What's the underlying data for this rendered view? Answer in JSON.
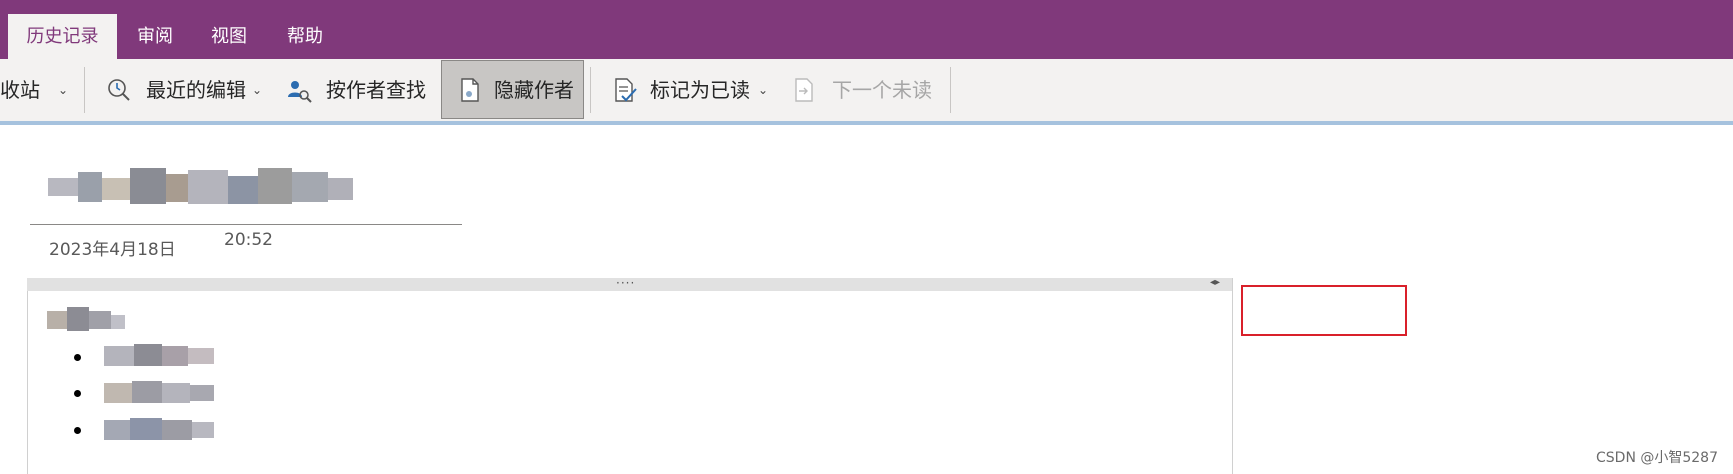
{
  "tabs": [
    {
      "label": "历史记录",
      "active": true
    },
    {
      "label": "审阅",
      "active": false
    },
    {
      "label": "视图",
      "active": false
    },
    {
      "label": "帮助",
      "active": false
    }
  ],
  "ribbon": {
    "recycle_bin": "回收站",
    "recent_edits": "最近的编辑",
    "find_by_author": "按作者查找",
    "hide_authors": "隐藏作者",
    "mark_as_read": "标记为已读",
    "next_unread": "下一个未读"
  },
  "page": {
    "date": "2023年4月18日",
    "time": "20:52"
  },
  "watermark": "CSDN @小智5287",
  "colors": {
    "accent": "#80397b",
    "ribbon_bg": "#f3f2f1",
    "highlight_box": "#d9202a"
  }
}
